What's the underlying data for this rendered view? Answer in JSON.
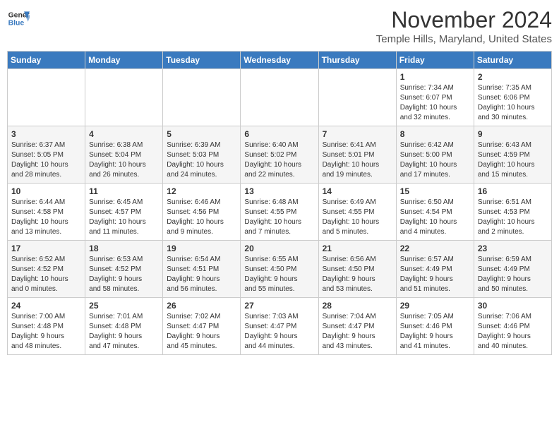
{
  "app": {
    "name_line1": "General",
    "name_line2": "Blue"
  },
  "header": {
    "month": "November 2024",
    "location": "Temple Hills, Maryland, United States"
  },
  "weekdays": [
    "Sunday",
    "Monday",
    "Tuesday",
    "Wednesday",
    "Thursday",
    "Friday",
    "Saturday"
  ],
  "weeks": [
    [
      {
        "day": "",
        "info": ""
      },
      {
        "day": "",
        "info": ""
      },
      {
        "day": "",
        "info": ""
      },
      {
        "day": "",
        "info": ""
      },
      {
        "day": "",
        "info": ""
      },
      {
        "day": "1",
        "info": "Sunrise: 7:34 AM\nSunset: 6:07 PM\nDaylight: 10 hours\nand 32 minutes."
      },
      {
        "day": "2",
        "info": "Sunrise: 7:35 AM\nSunset: 6:06 PM\nDaylight: 10 hours\nand 30 minutes."
      }
    ],
    [
      {
        "day": "3",
        "info": "Sunrise: 6:37 AM\nSunset: 5:05 PM\nDaylight: 10 hours\nand 28 minutes."
      },
      {
        "day": "4",
        "info": "Sunrise: 6:38 AM\nSunset: 5:04 PM\nDaylight: 10 hours\nand 26 minutes."
      },
      {
        "day": "5",
        "info": "Sunrise: 6:39 AM\nSunset: 5:03 PM\nDaylight: 10 hours\nand 24 minutes."
      },
      {
        "day": "6",
        "info": "Sunrise: 6:40 AM\nSunset: 5:02 PM\nDaylight: 10 hours\nand 22 minutes."
      },
      {
        "day": "7",
        "info": "Sunrise: 6:41 AM\nSunset: 5:01 PM\nDaylight: 10 hours\nand 19 minutes."
      },
      {
        "day": "8",
        "info": "Sunrise: 6:42 AM\nSunset: 5:00 PM\nDaylight: 10 hours\nand 17 minutes."
      },
      {
        "day": "9",
        "info": "Sunrise: 6:43 AM\nSunset: 4:59 PM\nDaylight: 10 hours\nand 15 minutes."
      }
    ],
    [
      {
        "day": "10",
        "info": "Sunrise: 6:44 AM\nSunset: 4:58 PM\nDaylight: 10 hours\nand 13 minutes."
      },
      {
        "day": "11",
        "info": "Sunrise: 6:45 AM\nSunset: 4:57 PM\nDaylight: 10 hours\nand 11 minutes."
      },
      {
        "day": "12",
        "info": "Sunrise: 6:46 AM\nSunset: 4:56 PM\nDaylight: 10 hours\nand 9 minutes."
      },
      {
        "day": "13",
        "info": "Sunrise: 6:48 AM\nSunset: 4:55 PM\nDaylight: 10 hours\nand 7 minutes."
      },
      {
        "day": "14",
        "info": "Sunrise: 6:49 AM\nSunset: 4:55 PM\nDaylight: 10 hours\nand 5 minutes."
      },
      {
        "day": "15",
        "info": "Sunrise: 6:50 AM\nSunset: 4:54 PM\nDaylight: 10 hours\nand 4 minutes."
      },
      {
        "day": "16",
        "info": "Sunrise: 6:51 AM\nSunset: 4:53 PM\nDaylight: 10 hours\nand 2 minutes."
      }
    ],
    [
      {
        "day": "17",
        "info": "Sunrise: 6:52 AM\nSunset: 4:52 PM\nDaylight: 10 hours\nand 0 minutes."
      },
      {
        "day": "18",
        "info": "Sunrise: 6:53 AM\nSunset: 4:52 PM\nDaylight: 9 hours\nand 58 minutes."
      },
      {
        "day": "19",
        "info": "Sunrise: 6:54 AM\nSunset: 4:51 PM\nDaylight: 9 hours\nand 56 minutes."
      },
      {
        "day": "20",
        "info": "Sunrise: 6:55 AM\nSunset: 4:50 PM\nDaylight: 9 hours\nand 55 minutes."
      },
      {
        "day": "21",
        "info": "Sunrise: 6:56 AM\nSunset: 4:50 PM\nDaylight: 9 hours\nand 53 minutes."
      },
      {
        "day": "22",
        "info": "Sunrise: 6:57 AM\nSunset: 4:49 PM\nDaylight: 9 hours\nand 51 minutes."
      },
      {
        "day": "23",
        "info": "Sunrise: 6:59 AM\nSunset: 4:49 PM\nDaylight: 9 hours\nand 50 minutes."
      }
    ],
    [
      {
        "day": "24",
        "info": "Sunrise: 7:00 AM\nSunset: 4:48 PM\nDaylight: 9 hours\nand 48 minutes."
      },
      {
        "day": "25",
        "info": "Sunrise: 7:01 AM\nSunset: 4:48 PM\nDaylight: 9 hours\nand 47 minutes."
      },
      {
        "day": "26",
        "info": "Sunrise: 7:02 AM\nSunset: 4:47 PM\nDaylight: 9 hours\nand 45 minutes."
      },
      {
        "day": "27",
        "info": "Sunrise: 7:03 AM\nSunset: 4:47 PM\nDaylight: 9 hours\nand 44 minutes."
      },
      {
        "day": "28",
        "info": "Sunrise: 7:04 AM\nSunset: 4:47 PM\nDaylight: 9 hours\nand 43 minutes."
      },
      {
        "day": "29",
        "info": "Sunrise: 7:05 AM\nSunset: 4:46 PM\nDaylight: 9 hours\nand 41 minutes."
      },
      {
        "day": "30",
        "info": "Sunrise: 7:06 AM\nSunset: 4:46 PM\nDaylight: 9 hours\nand 40 minutes."
      }
    ]
  ]
}
